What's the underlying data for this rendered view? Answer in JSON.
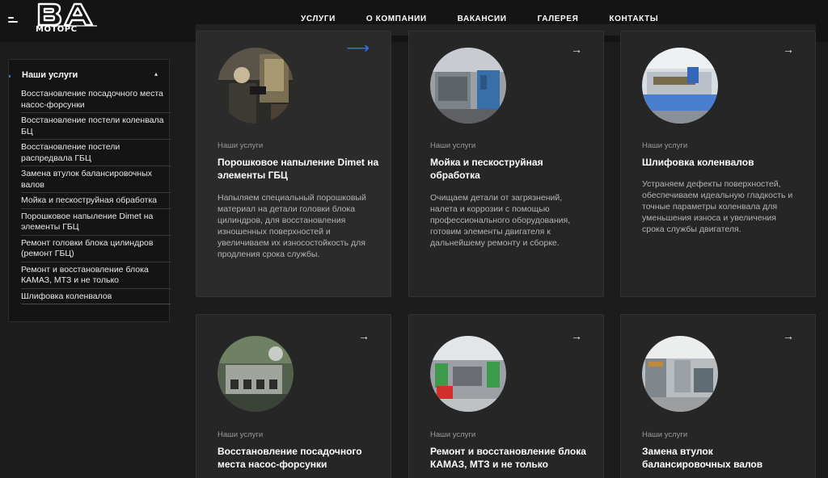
{
  "header": {
    "logo_sub": "МОТОРС",
    "nav": [
      "УСЛУГИ",
      "О КОМПАНИИ",
      "ВАКАНСИИ",
      "ГАЛЕРЕЯ",
      "КОНТАКТЫ"
    ]
  },
  "sidebar": {
    "title": "Наши услуги",
    "chevron_icon": "chevron-up-icon",
    "items": [
      "Восстановление посадочного места насос-форсунки",
      "Восстановление постели коленвала БЦ",
      "Восстановление постели распредвала ГБЦ",
      "Замена втулок балансировочных валов",
      "Мойка и пескоструйная обработка",
      "Порошковое напыление Dimet на элементы ГБЦ",
      "Ремонт головки блока цилиндров (ремонт ГБЦ)",
      "Ремонт и восстановление блока КАМАЗ, МТЗ и не только",
      "Шлифовка коленвалов"
    ]
  },
  "cards": [
    {
      "category": "Наши услуги",
      "title": "Порошковое напыление Dimet на элементы ГБЦ",
      "desc": "Напыляем специальный порошковый материал на детали головки блока цилиндров, для восстановления изношенных поверхностей и увеличиваем их износостойкость для продления срока службы.",
      "arrow": "⟶"
    },
    {
      "category": "Наши услуги",
      "title": "Мойка и пескоструйная обработка",
      "desc": "Очищаем детали от загрязнений, налета и коррозии с помощью профессионального оборудования, готовим элементы двигателя к дальнейшему ремонту и сборке.",
      "arrow": "→"
    },
    {
      "category": "Наши услуги",
      "title": "Шлифовка коленвалов",
      "desc": "Устраняем дефекты поверхностей, обеспечиваем идеальную гладкость и точные параметры коленвала для уменьшения износа и увеличения срока службы двигателя.",
      "arrow": "→"
    },
    {
      "category": "Наши услуги",
      "title": "Восстановление посадочного места насос-форсунки",
      "desc": "",
      "arrow": "→"
    },
    {
      "category": "Наши услуги",
      "title": "Ремонт и восстановление блока КАМАЗ, МТЗ и не только",
      "desc": "",
      "arrow": "→"
    },
    {
      "category": "Наши услуги",
      "title": "Замена втулок балансировочных валов",
      "desc": "",
      "arrow": "→"
    }
  ],
  "colors": {
    "accent": "#3b6fe0",
    "background": "#1c1c1c",
    "card": "#262626"
  }
}
